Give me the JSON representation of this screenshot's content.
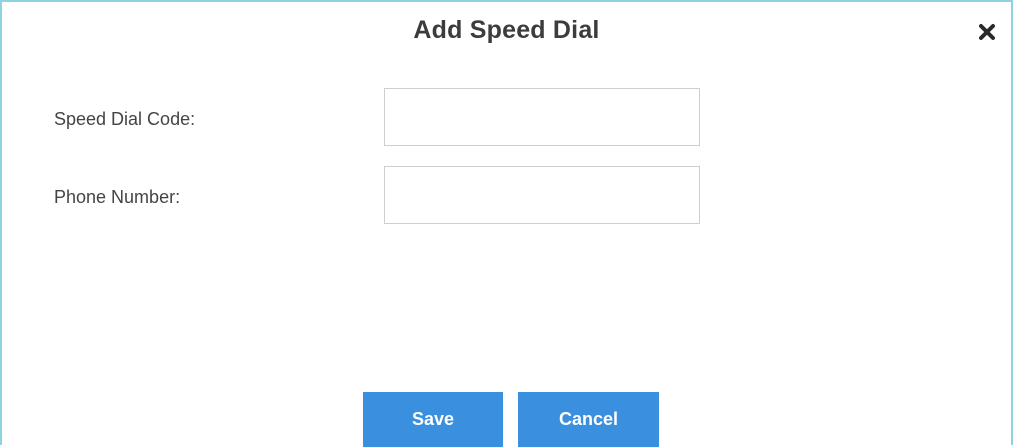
{
  "dialog": {
    "title": "Add Speed Dial",
    "close_icon": "close-icon"
  },
  "form": {
    "speed_dial_code": {
      "label": "Speed Dial Code:",
      "value": "",
      "placeholder": ""
    },
    "phone_number": {
      "label": "Phone Number:",
      "value": "",
      "placeholder": ""
    }
  },
  "actions": {
    "save_label": "Save",
    "cancel_label": "Cancel"
  },
  "colors": {
    "border_accent": "#8fd3e0",
    "button_primary": "#3a8fdf",
    "title_text": "#3c3c3c"
  }
}
